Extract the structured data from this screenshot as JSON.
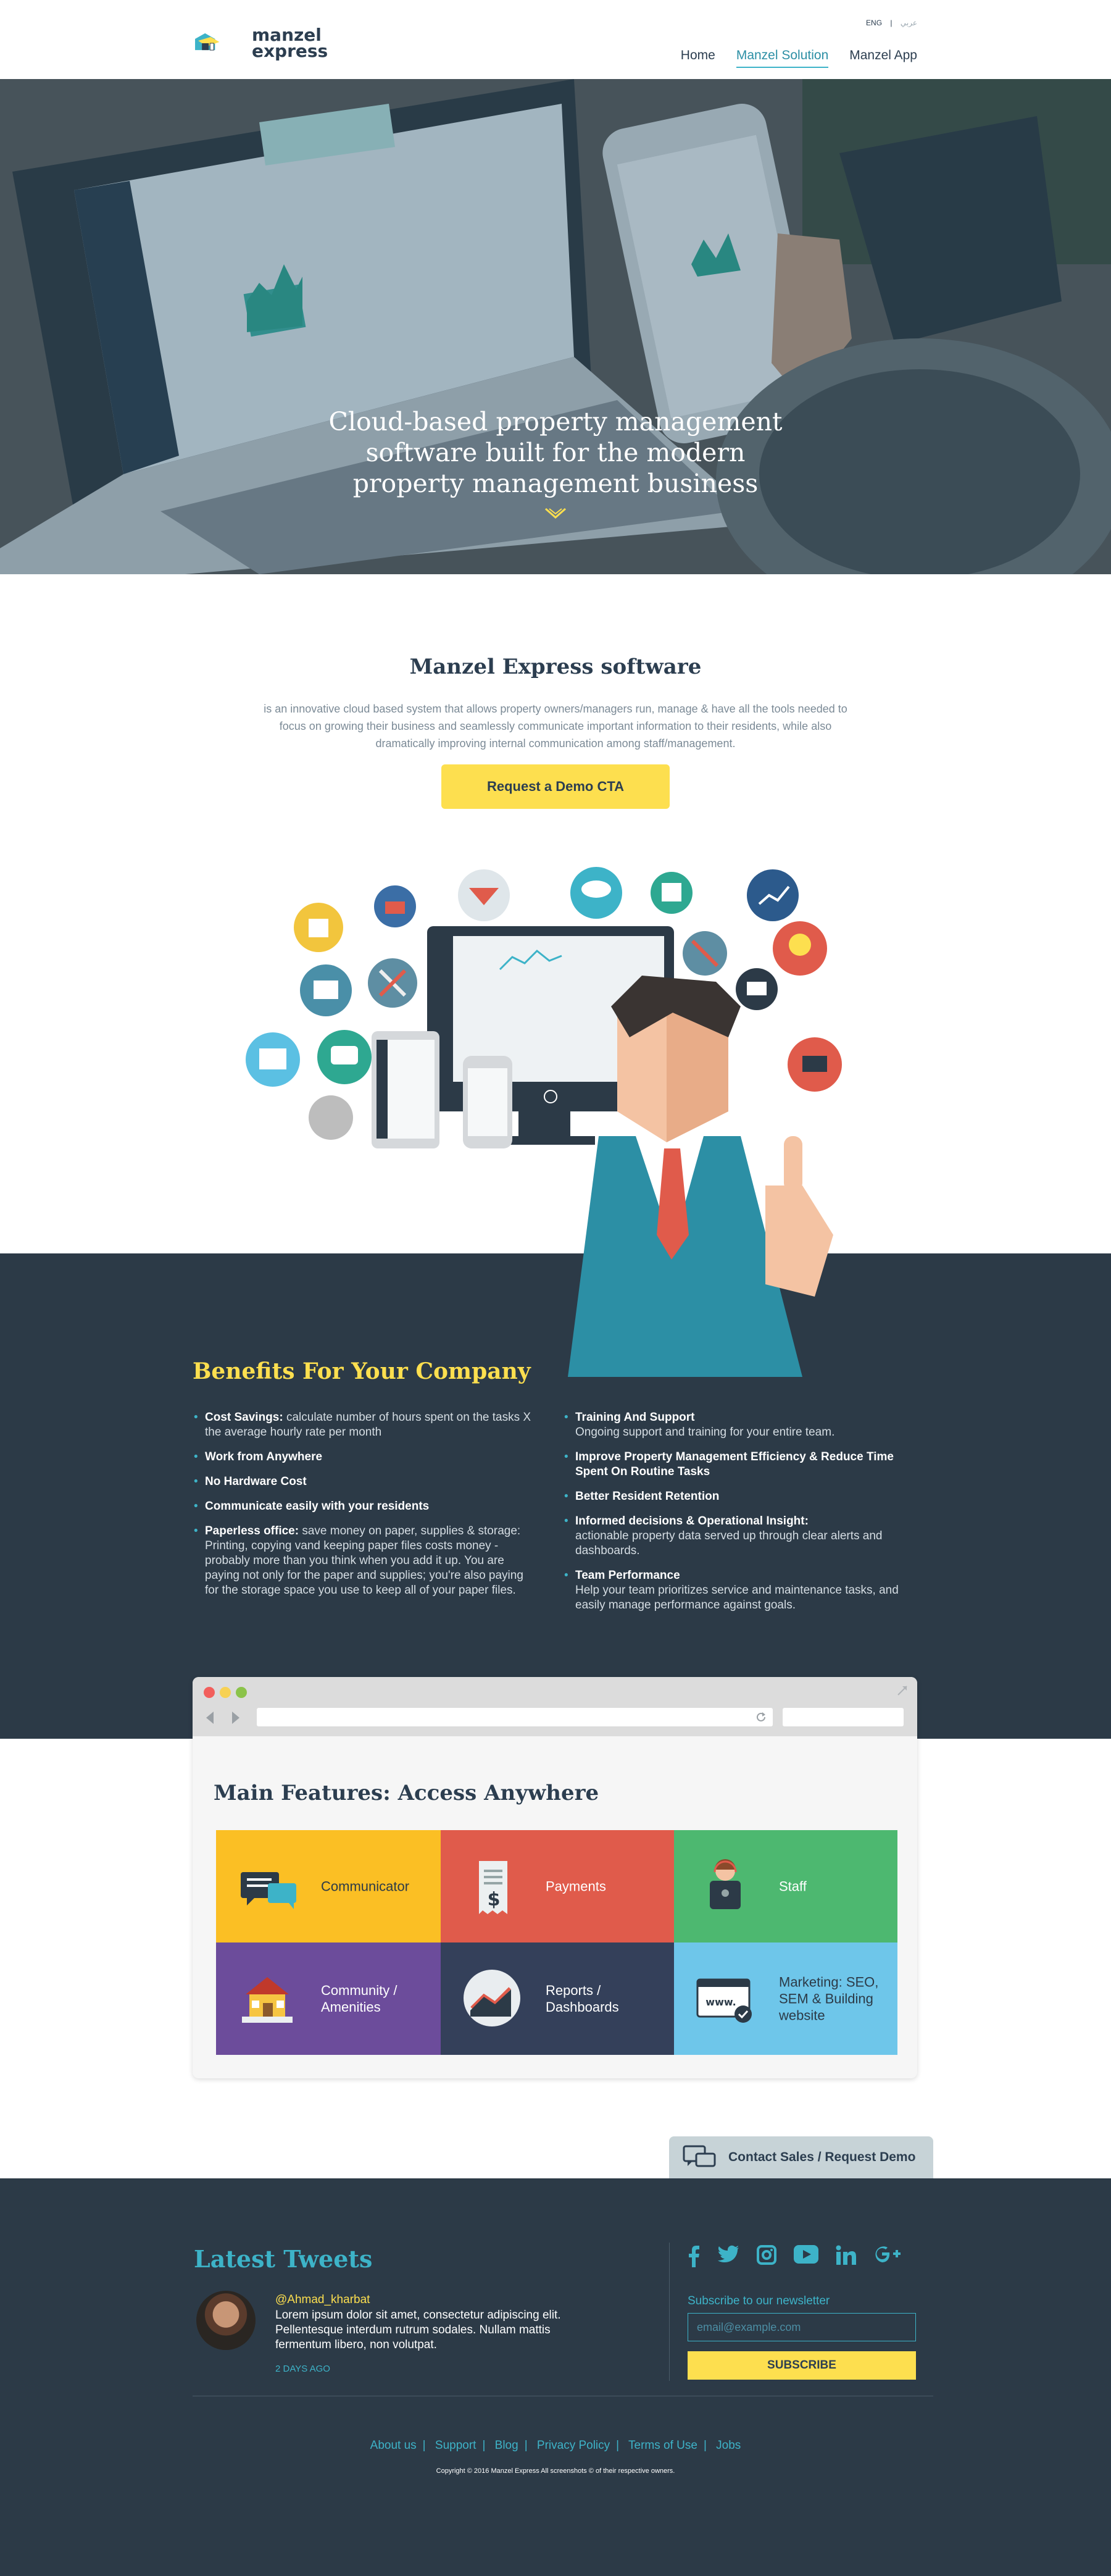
{
  "header": {
    "logo_text_1": "manzel",
    "logo_text_2": "express",
    "lang_en": "ENG",
    "lang_sep": "|",
    "lang_ar": "عربي",
    "nav": [
      "Home",
      "Manzel Solution",
      "Manzel App"
    ]
  },
  "hero": {
    "title_lines": [
      "Cloud-based property management",
      "software built for the modern",
      "property management business"
    ]
  },
  "intro": {
    "title": "Manzel Express software",
    "text": "is an innovative cloud based system that allows property owners/managers run, manage & have all the tools needed to focus on growing their business and seamlessly communicate important information to their residents, while also dramatically improving internal communication among staff/management.",
    "cta_label": "Request a Demo CTA"
  },
  "benefits": {
    "title": "Benefits For Your Company",
    "left": [
      {
        "title": "Cost Savings:",
        "desc": " calculate number of hours spent on the tasks X the average hourly rate per month"
      },
      {
        "title": "Work from Anywhere",
        "desc": ""
      },
      {
        "title": "No Hardware Cost",
        "desc": ""
      },
      {
        "title": "Communicate easily with your residents",
        "desc": ""
      },
      {
        "title": "Paperless office:",
        "desc": " save money on paper, supplies & storage: Printing, copying vand keeping paper files costs money - probably more than you think when you add it up. You are paying not only for the paper and supplies; you're also paying for the storage space you use to keep all of your paper files."
      }
    ],
    "right": [
      {
        "title": "Training And Support",
        "desc": "Ongoing support and training for your entire team."
      },
      {
        "title": "Improve Property Management Efficiency & Reduce Time Spent On Routine Tasks",
        "desc": ""
      },
      {
        "title": "Better Resident Retention",
        "desc": ""
      },
      {
        "title": "Informed decisions & Operational Insight:",
        "desc": "actionable property data served up through clear alerts and dashboards."
      },
      {
        "title": "Team Performance",
        "desc": "Help your team prioritizes service and maintenance tasks, and easily manage performance against goals."
      }
    ]
  },
  "features": {
    "title": "Main Features: Access Anywhere",
    "tiles": [
      {
        "label": "Communicator",
        "color": "#fbbf24",
        "icon": "chat-icon"
      },
      {
        "label": "Payments",
        "color": "#e05b4b",
        "icon": "invoice-icon"
      },
      {
        "label": "Staff",
        "color": "#4db870",
        "icon": "staff-icon"
      },
      {
        "label": "Community / Amenities",
        "color": "#6c4c9b",
        "icon": "house-icon"
      },
      {
        "label": "Reports / Dashboards",
        "color": "#34405a",
        "icon": "chart-icon"
      },
      {
        "label": "Marketing: SEO, SEM & Building website",
        "color": "#6ec6ea",
        "icon": "website-icon"
      }
    ]
  },
  "contact": {
    "label": "Contact Sales / Request Demo"
  },
  "footer": {
    "tweets_title": "Latest Tweets",
    "tweet_handle": "@Ahmad_kharbat",
    "tweet_text": "Lorem ipsum dolor sit amet, consectetur adipiscing elit. Pellentesque interdum rutrum sodales. Nullam mattis fermentum libero, non volutpat.",
    "tweet_time": "2 DAYS AGO",
    "social": [
      "facebook-icon",
      "twitter-icon",
      "instagram-icon",
      "youtube-icon",
      "linkedin-icon",
      "google-plus-icon"
    ],
    "newsletter_label": "Subscribe to our newsletter",
    "newsletter_placeholder": "email@example.com",
    "subscribe_label": "SUBSCRIBE",
    "links": [
      "About us",
      "Support",
      "Blog",
      "Privacy Policy",
      "Terms of Use",
      "Jobs"
    ],
    "copyright": "Copyright © 2016 Manzel Express All screenshots © of their respective owners."
  }
}
